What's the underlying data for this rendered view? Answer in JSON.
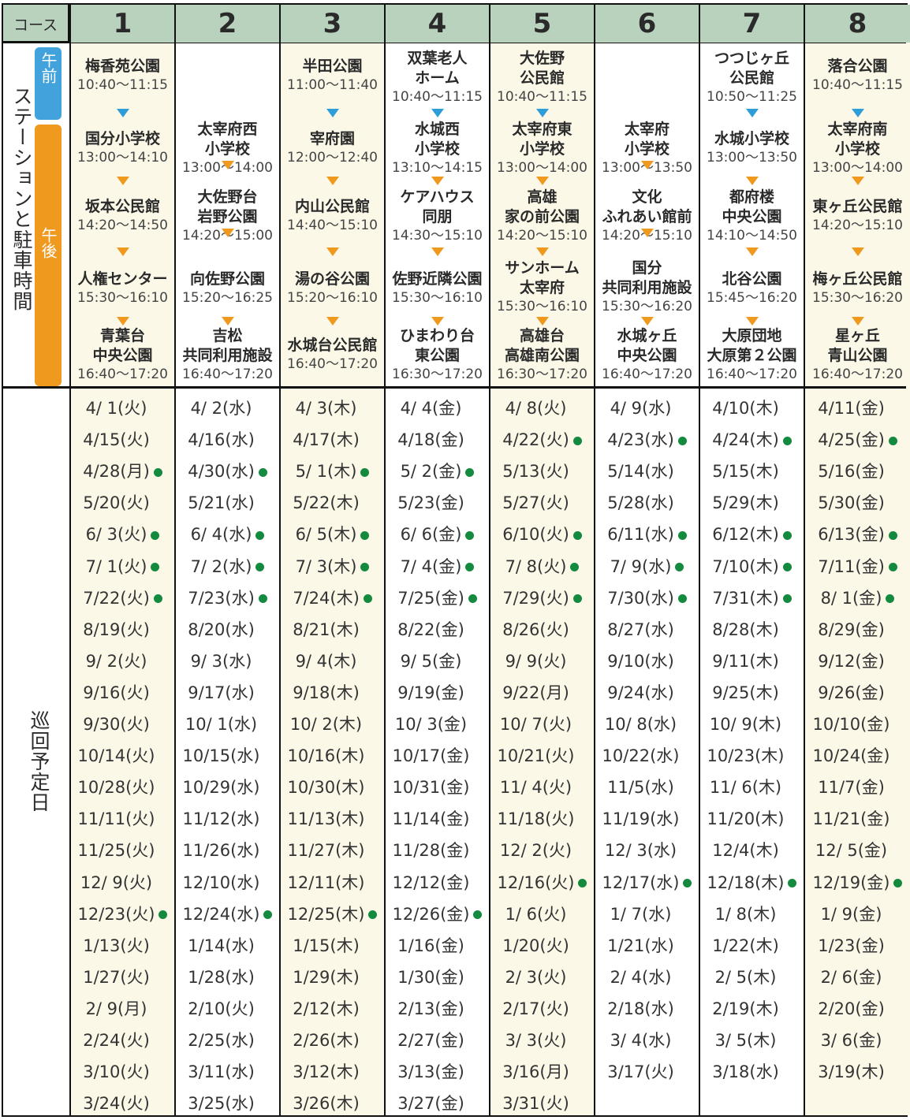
{
  "header": {
    "course_label": "コース"
  },
  "labels": {
    "stations": "ステーションと駐車時間",
    "am": "午前",
    "pm": "午後",
    "schedule": "巡回予定日"
  },
  "colors": {
    "header_bg": "#b8d2be",
    "am_tag": "#42a3dc",
    "pm_tag": "#ef9a1e",
    "dot": "#138a3e",
    "shade": "#fbf8e8"
  },
  "courses": [
    {
      "number": "1",
      "stops": [
        {
          "name": "梅香苑公園",
          "time": "10:40〜11:15"
        },
        {
          "name": "国分小学校",
          "time": "13:00〜14:10"
        },
        {
          "name": "坂本公民館",
          "time": "14:20〜14:50"
        },
        {
          "name": "人権センター",
          "time": "15:30〜16:10"
        },
        {
          "name": "青葉台\n中央公園",
          "time": "16:40〜17:20"
        }
      ],
      "dates": [
        "4/ 1(火)",
        "4/15(火)",
        "4/28(月) ●",
        "5/20(火)",
        "6/ 3(火) ●",
        "7/ 1(火) ●",
        "7/22(火) ●",
        "8/19(火)",
        "9/ 2(火)",
        "9/16(火)",
        "9/30(火)",
        "10/14(火)",
        "10/28(火)",
        "11/11(火)",
        "11/25(火)",
        "12/ 9(火)",
        "12/23(火) ●",
        "1/13(火)",
        "1/27(火)",
        "2/ 9(月)",
        "2/24(火)",
        "3/10(火)",
        "3/24(火)"
      ]
    },
    {
      "number": "2",
      "stops": [
        {
          "name": "太宰府西\n小学校",
          "time": "13:00〜14:00"
        },
        {
          "name": "大佐野台\n岩野公園",
          "time": "14:20〜15:00"
        },
        {
          "name": "向佐野公園",
          "time": "15:20〜16:25"
        },
        {
          "name": "吉松\n共同利用施設",
          "time": "16:40〜17:20"
        }
      ],
      "dates": [
        "4/ 2(水)",
        "4/16(水)",
        "4/30(水) ●",
        "5/21(水)",
        "6/ 4(水) ●",
        "7/ 2(水) ●",
        "7/23(水) ●",
        "8/20(水)",
        "9/ 3(水)",
        "9/17(水)",
        "10/ 1(水)",
        "10/15(水)",
        "10/29(水)",
        "11/12(水)",
        "11/26(水)",
        "12/10(水)",
        "12/24(水) ●",
        "1/14(水)",
        "1/28(水)",
        "2/10(火)",
        "2/25(水)",
        "3/11(水)",
        "3/25(水)"
      ]
    },
    {
      "number": "3",
      "stops": [
        {
          "name": "半田公園",
          "time": "11:00〜11:40"
        },
        {
          "name": "宰府園",
          "time": "12:00〜12:40"
        },
        {
          "name": "内山公民館",
          "time": "14:40〜15:10"
        },
        {
          "name": "湯の谷公園",
          "time": "15:20〜16:10"
        },
        {
          "name": "水城台公民館",
          "time": "16:40〜17:20"
        }
      ],
      "dates": [
        "4/ 3(木)",
        "4/17(木)",
        "5/ 1(木) ●",
        "5/22(木)",
        "6/ 5(木) ●",
        "7/ 3(木) ●",
        "7/24(木) ●",
        "8/21(木)",
        "9/ 4(木)",
        "9/18(木)",
        "10/ 2(木)",
        "10/16(木)",
        "10/30(木)",
        "11/13(木)",
        "11/27(木)",
        "12/11(木)",
        "12/25(木) ●",
        "1/15(木)",
        "1/29(木)",
        "2/12(木)",
        "2/26(木)",
        "3/12(木)",
        "3/26(木)"
      ]
    },
    {
      "number": "4",
      "stops": [
        {
          "name": "双葉老人\nホーム",
          "time": "10:40〜11:15"
        },
        {
          "name": "水城西\n小学校",
          "time": "13:10〜14:15"
        },
        {
          "name": "ケアハウス\n同朋",
          "time": "14:30〜15:10"
        },
        {
          "name": "佐野近隣公園",
          "time": "15:30〜16:10"
        },
        {
          "name": "ひまわり台\n東公園",
          "time": "16:30〜17:20"
        }
      ],
      "dates": [
        "4/ 4(金)",
        "4/18(金)",
        "5/ 2(金) ●",
        "5/23(金)",
        "6/ 6(金) ●",
        "7/ 4(金) ●",
        "7/25(金) ●",
        "8/22(金)",
        "9/ 5(金)",
        "9/19(金)",
        "10/ 3(金)",
        "10/17(金)",
        "10/31(金)",
        "11/14(金)",
        "11/28(金)",
        "12/12(金)",
        "12/26(金) ●",
        "1/16(金)",
        "1/30(金)",
        "2/13(金)",
        "2/27(金)",
        "3/13(金)",
        "3/27(金)"
      ]
    },
    {
      "number": "5",
      "stops": [
        {
          "name": "大佐野\n公民館",
          "time": "10:40〜11:15"
        },
        {
          "name": "太宰府東\n小学校",
          "time": "13:00〜14:00"
        },
        {
          "name": "高雄\n家の前公園",
          "time": "14:20〜15:10"
        },
        {
          "name": "サンホーム\n太宰府",
          "time": "15:30〜16:10"
        },
        {
          "name": "高雄台\n高雄南公園",
          "time": "16:30〜17:20"
        }
      ],
      "dates": [
        "4/ 8(火)",
        "4/22(火) ●",
        "5/13(火)",
        "5/27(火)",
        "6/10(火) ●",
        "7/ 8(火) ●",
        "7/29(火) ●",
        "8/26(火)",
        "9/ 9(火)",
        "9/22(月)",
        "10/ 7(火)",
        "10/21(火)",
        "11/ 4(火)",
        "11/18(火)",
        "12/ 2(火)",
        "12/16(火) ●",
        "1/ 6(火)",
        "1/20(火)",
        "2/ 3(火)",
        "2/17(火)",
        "3/ 3(火)",
        "3/16(月)",
        "3/31(火)"
      ]
    },
    {
      "number": "6",
      "stops": [
        {
          "name": "太宰府\n小学校",
          "time": "13:00〜13:50"
        },
        {
          "name": "文化\nふれあい館前",
          "time": "14:20〜15:10"
        },
        {
          "name": "国分\n共同利用施設",
          "time": "15:30〜16:20"
        },
        {
          "name": "水城ヶ丘\n中央公園",
          "time": "16:40〜17:20"
        }
      ],
      "dates": [
        "4/ 9(水)",
        "4/23(水) ●",
        "5/14(水)",
        "5/28(水)",
        "6/11(水) ●",
        "7/ 9(水) ●",
        "7/30(水) ●",
        "8/27(水)",
        "9/10(水)",
        "9/24(水)",
        "10/ 8(水)",
        "10/22(水)",
        "11/5(水)",
        "11/19(水)",
        "12/ 3(水)",
        "12/17(水) ●",
        "1/ 7(水)",
        "1/21(水)",
        "2/ 4(水)",
        "2/18(水)",
        "3/ 4(水)",
        "3/17(火)",
        ""
      ]
    },
    {
      "number": "7",
      "stops": [
        {
          "name": "つつじヶ丘\n公民館",
          "time": "10:50〜11:25"
        },
        {
          "name": "水城小学校",
          "time": "13:00〜13:50"
        },
        {
          "name": "都府楼\n中央公園",
          "time": "14:10〜14:50"
        },
        {
          "name": "北谷公園",
          "time": "15:45〜16:20"
        },
        {
          "name": "大原団地\n大原第２公園",
          "time": "16:40〜17:20"
        }
      ],
      "dates": [
        "4/10(木)",
        "4/24(木) ●",
        "5/15(木)",
        "5/29(木)",
        "6/12(木) ●",
        "7/10(木) ●",
        "7/31(木) ●",
        "8/28(木)",
        "9/11(木)",
        "9/25(木)",
        "10/ 9(木)",
        "10/23(木)",
        "11/ 6(木)",
        "11/20(木)",
        "12/4(木)",
        "12/18(木) ●",
        "1/ 8(木)",
        "1/22(木)",
        "2/ 5(木)",
        "2/19(木)",
        "3/ 5(木)",
        "3/18(水)",
        ""
      ]
    },
    {
      "number": "8",
      "stops": [
        {
          "name": "落合公園",
          "time": "10:40〜11:15"
        },
        {
          "name": "太宰府南\n小学校",
          "time": "13:00〜14:00"
        },
        {
          "name": "東ヶ丘公民館",
          "time": "14:20〜15:10"
        },
        {
          "name": "梅ヶ丘公民館",
          "time": "15:30〜16:20"
        },
        {
          "name": "星ヶ丘\n青山公園",
          "time": "16:40〜17:20"
        }
      ],
      "dates": [
        "4/11(金)",
        "4/25(金) ●",
        "5/16(金)",
        "5/30(金)",
        "6/13(金) ●",
        "7/11(金) ●",
        "8/ 1(金) ●",
        "8/29(金)",
        "9/12(金)",
        "9/26(金)",
        "10/10(金)",
        "10/24(金)",
        "11/7(金)",
        "11/21(金)",
        "12/ 5(金)",
        "12/19(金) ●",
        "1/ 9(金)",
        "1/23(金)",
        "2/ 6(金)",
        "2/20(金)",
        "3/ 6(金)",
        "3/19(木)",
        ""
      ]
    }
  ]
}
